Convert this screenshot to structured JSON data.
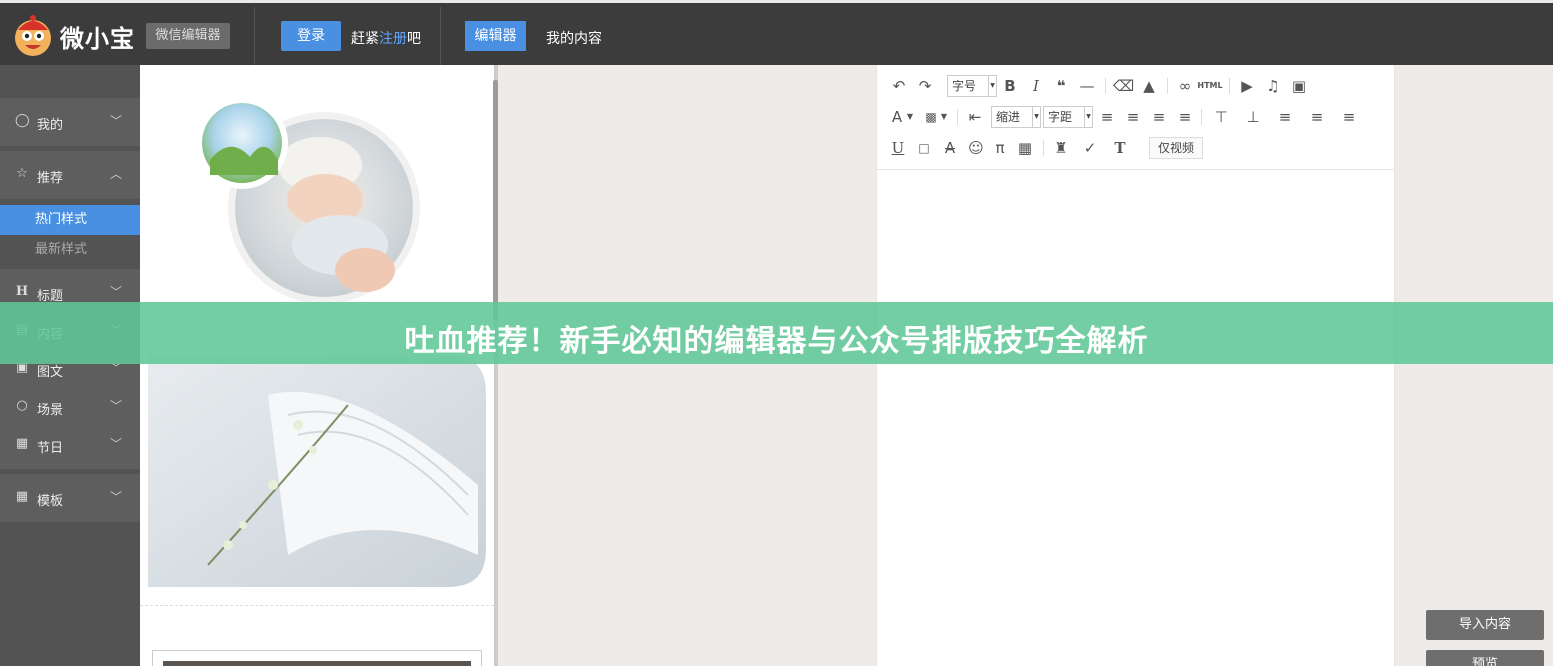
{
  "header": {
    "brand": "微小宝",
    "brand_tag": "微信编辑器",
    "login_label": "登录",
    "register_prefix": "赶紧",
    "register_link": "注册",
    "register_suffix": "吧",
    "nav_editor": "编辑器",
    "nav_my_content": "我的内容"
  },
  "sidebar": {
    "items": [
      {
        "label": "我的",
        "icon": "user-icon",
        "chevron": "﹀"
      },
      {
        "label": "推荐",
        "icon": "star-icon",
        "chevron": "︿"
      },
      {
        "label": "标题",
        "icon": "heading-icon",
        "chevron": "﹀"
      },
      {
        "label": "内容",
        "icon": "document-icon",
        "chevron": "﹀"
      },
      {
        "label": "图文",
        "icon": "image-icon",
        "chevron": "﹀"
      },
      {
        "label": "场景",
        "icon": "chat-bubble-icon",
        "chevron": "﹀"
      },
      {
        "label": "节日",
        "icon": "calendar-icon",
        "chevron": "﹀"
      },
      {
        "label": "模板",
        "icon": "grid-icon",
        "chevron": "﹀"
      }
    ],
    "subitems": [
      {
        "label": "热门样式"
      },
      {
        "label": "最新样式"
      }
    ]
  },
  "toolbar": {
    "font_size": "字号",
    "indent": "缩进",
    "letter_spacing": "字距",
    "html": "HTML",
    "video_only": "仅视频"
  },
  "actions": {
    "import": "导入内容",
    "preview": "预览"
  },
  "banner": {
    "text": "吐血推荐！新手必知的编辑器与公众号排版技巧全解析"
  },
  "colors": {
    "accent": "#4a90e2",
    "topbar": "#3c3c3c",
    "sidebar": "#535353",
    "banner": "#60c896"
  }
}
